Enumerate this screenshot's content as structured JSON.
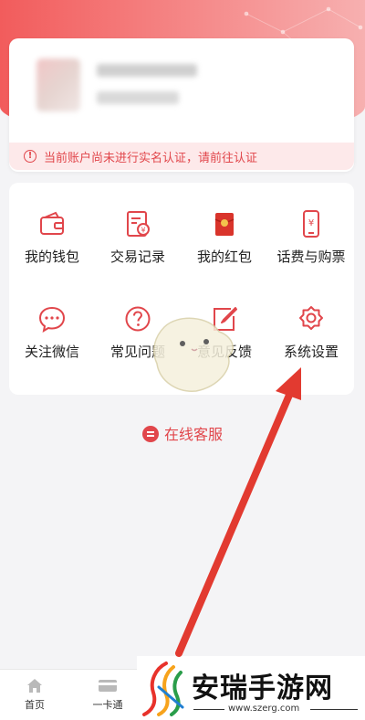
{
  "profile": {
    "notice_icon": "warning-circle-icon",
    "notice_text": "当前账户尚未进行实名认证，请前往认证"
  },
  "menu": {
    "items": [
      {
        "label": "我的钱包",
        "icon": "wallet-icon"
      },
      {
        "label": "交易记录",
        "icon": "transaction-record-icon"
      },
      {
        "label": "我的红包",
        "icon": "red-envelope-icon"
      },
      {
        "label": "话费与购票",
        "icon": "phone-bill-icon"
      },
      {
        "label": "关注微信",
        "icon": "wechat-chat-icon"
      },
      {
        "label": "常见问题",
        "icon": "question-icon"
      },
      {
        "label": "意见反馈",
        "icon": "feedback-edit-icon"
      },
      {
        "label": "系统设置",
        "icon": "gear-icon"
      }
    ]
  },
  "service": {
    "label": "在线客服"
  },
  "tabbar": {
    "tabs": [
      {
        "label": "首页",
        "icon": "home-icon"
      },
      {
        "label": "一卡通",
        "icon": "card-icon"
      }
    ]
  },
  "watermark": {
    "title": "安瑞手游网",
    "url": "www.szerg.com"
  },
  "colors": {
    "accent": "#e1464b",
    "hero_start": "#f25c5c",
    "notice_bg": "#fde9ea"
  }
}
